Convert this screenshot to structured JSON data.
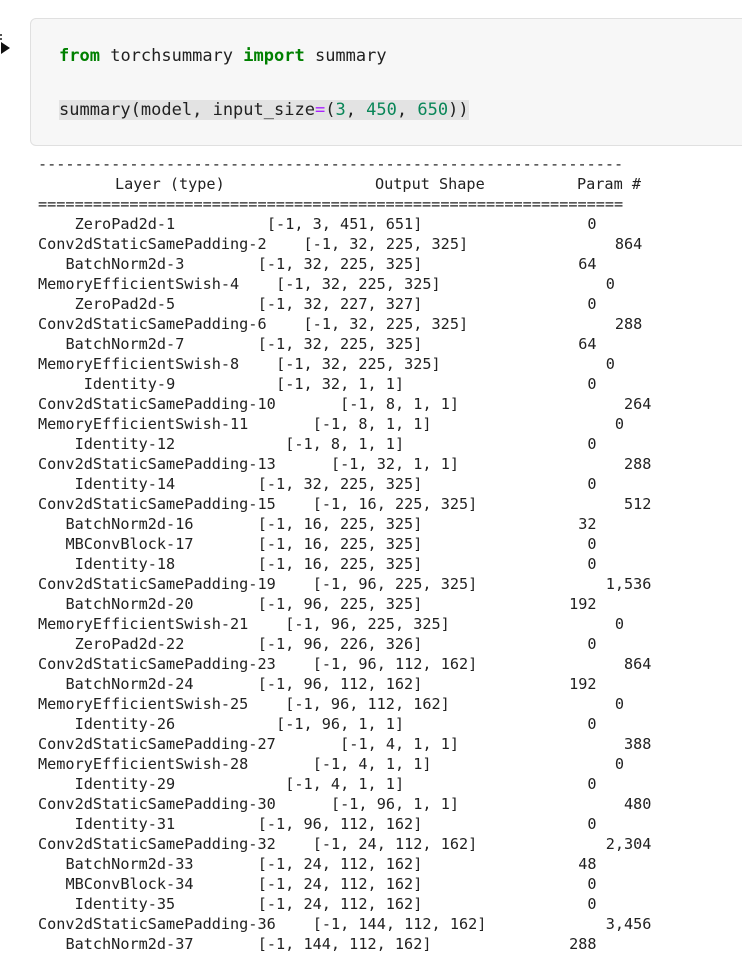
{
  "code": {
    "line1": {
      "kw1": "from",
      "mod": "torchsummary",
      "kw2": "import",
      "name": "summary"
    },
    "line2": {
      "fn": "summary",
      "open": "(",
      "arg": "model",
      "sep1": ", ",
      "kwarg": "input_size",
      "eq": "=",
      "tuple_open": "(",
      "n1": "3",
      "sep2": ", ",
      "n2": "450",
      "sep3": ", ",
      "n3": "650",
      "close": "))"
    }
  },
  "output": {
    "rule_top": "----------------------------------------------------------------",
    "header": {
      "layer": "Layer (type)",
      "shape": "Output Shape",
      "param": "Param #"
    },
    "rule_double": "================================================================",
    "rows": [
      {
        "layer": "ZeroPad2d-1",
        "shape": "[-1, 3, 451, 651]",
        "param": "0"
      },
      {
        "layer": "Conv2dStaticSamePadding-2",
        "shape": "[-1, 32, 225, 325]",
        "param": "864"
      },
      {
        "layer": "BatchNorm2d-3",
        "shape": "[-1, 32, 225, 325]",
        "param": "64"
      },
      {
        "layer": "MemoryEfficientSwish-4",
        "shape": "[-1, 32, 225, 325]",
        "param": "0"
      },
      {
        "layer": "ZeroPad2d-5",
        "shape": "[-1, 32, 227, 327]",
        "param": "0"
      },
      {
        "layer": "Conv2dStaticSamePadding-6",
        "shape": "[-1, 32, 225, 325]",
        "param": "288"
      },
      {
        "layer": "BatchNorm2d-7",
        "shape": "[-1, 32, 225, 325]",
        "param": "64"
      },
      {
        "layer": "MemoryEfficientSwish-8",
        "shape": "[-1, 32, 225, 325]",
        "param": "0"
      },
      {
        "layer": "Identity-9",
        "shape": "[-1, 32, 1, 1]",
        "param": "0"
      },
      {
        "layer": "Conv2dStaticSamePadding-10",
        "shape": "[-1, 8, 1, 1]",
        "param": "264"
      },
      {
        "layer": "MemoryEfficientSwish-11",
        "shape": "[-1, 8, 1, 1]",
        "param": "0"
      },
      {
        "layer": "Identity-12",
        "shape": "[-1, 8, 1, 1]",
        "param": "0"
      },
      {
        "layer": "Conv2dStaticSamePadding-13",
        "shape": "[-1, 32, 1, 1]",
        "param": "288"
      },
      {
        "layer": "Identity-14",
        "shape": "[-1, 32, 225, 325]",
        "param": "0"
      },
      {
        "layer": "Conv2dStaticSamePadding-15",
        "shape": "[-1, 16, 225, 325]",
        "param": "512"
      },
      {
        "layer": "BatchNorm2d-16",
        "shape": "[-1, 16, 225, 325]",
        "param": "32"
      },
      {
        "layer": "MBConvBlock-17",
        "shape": "[-1, 16, 225, 325]",
        "param": "0"
      },
      {
        "layer": "Identity-18",
        "shape": "[-1, 16, 225, 325]",
        "param": "0"
      },
      {
        "layer": "Conv2dStaticSamePadding-19",
        "shape": "[-1, 96, 225, 325]",
        "param": "1,536"
      },
      {
        "layer": "BatchNorm2d-20",
        "shape": "[-1, 96, 225, 325]",
        "param": "192"
      },
      {
        "layer": "MemoryEfficientSwish-21",
        "shape": "[-1, 96, 225, 325]",
        "param": "0"
      },
      {
        "layer": "ZeroPad2d-22",
        "shape": "[-1, 96, 226, 326]",
        "param": "0"
      },
      {
        "layer": "Conv2dStaticSamePadding-23",
        "shape": "[-1, 96, 112, 162]",
        "param": "864"
      },
      {
        "layer": "BatchNorm2d-24",
        "shape": "[-1, 96, 112, 162]",
        "param": "192"
      },
      {
        "layer": "MemoryEfficientSwish-25",
        "shape": "[-1, 96, 112, 162]",
        "param": "0"
      },
      {
        "layer": "Identity-26",
        "shape": "[-1, 96, 1, 1]",
        "param": "0"
      },
      {
        "layer": "Conv2dStaticSamePadding-27",
        "shape": "[-1, 4, 1, 1]",
        "param": "388"
      },
      {
        "layer": "MemoryEfficientSwish-28",
        "shape": "[-1, 4, 1, 1]",
        "param": "0"
      },
      {
        "layer": "Identity-29",
        "shape": "[-1, 4, 1, 1]",
        "param": "0"
      },
      {
        "layer": "Conv2dStaticSamePadding-30",
        "shape": "[-1, 96, 1, 1]",
        "param": "480"
      },
      {
        "layer": "Identity-31",
        "shape": "[-1, 96, 112, 162]",
        "param": "0"
      },
      {
        "layer": "Conv2dStaticSamePadding-32",
        "shape": "[-1, 24, 112, 162]",
        "param": "2,304"
      },
      {
        "layer": "BatchNorm2d-33",
        "shape": "[-1, 24, 112, 162]",
        "param": "48"
      },
      {
        "layer": "MBConvBlock-34",
        "shape": "[-1, 24, 112, 162]",
        "param": "0"
      },
      {
        "layer": "Identity-35",
        "shape": "[-1, 24, 112, 162]",
        "param": "0"
      },
      {
        "layer": "Conv2dStaticSamePadding-36",
        "shape": "[-1, 144, 112, 162]",
        "param": "3,456"
      },
      {
        "layer": "BatchNorm2d-37",
        "shape": "[-1, 144, 112, 162]",
        "param": "288"
      }
    ]
  }
}
